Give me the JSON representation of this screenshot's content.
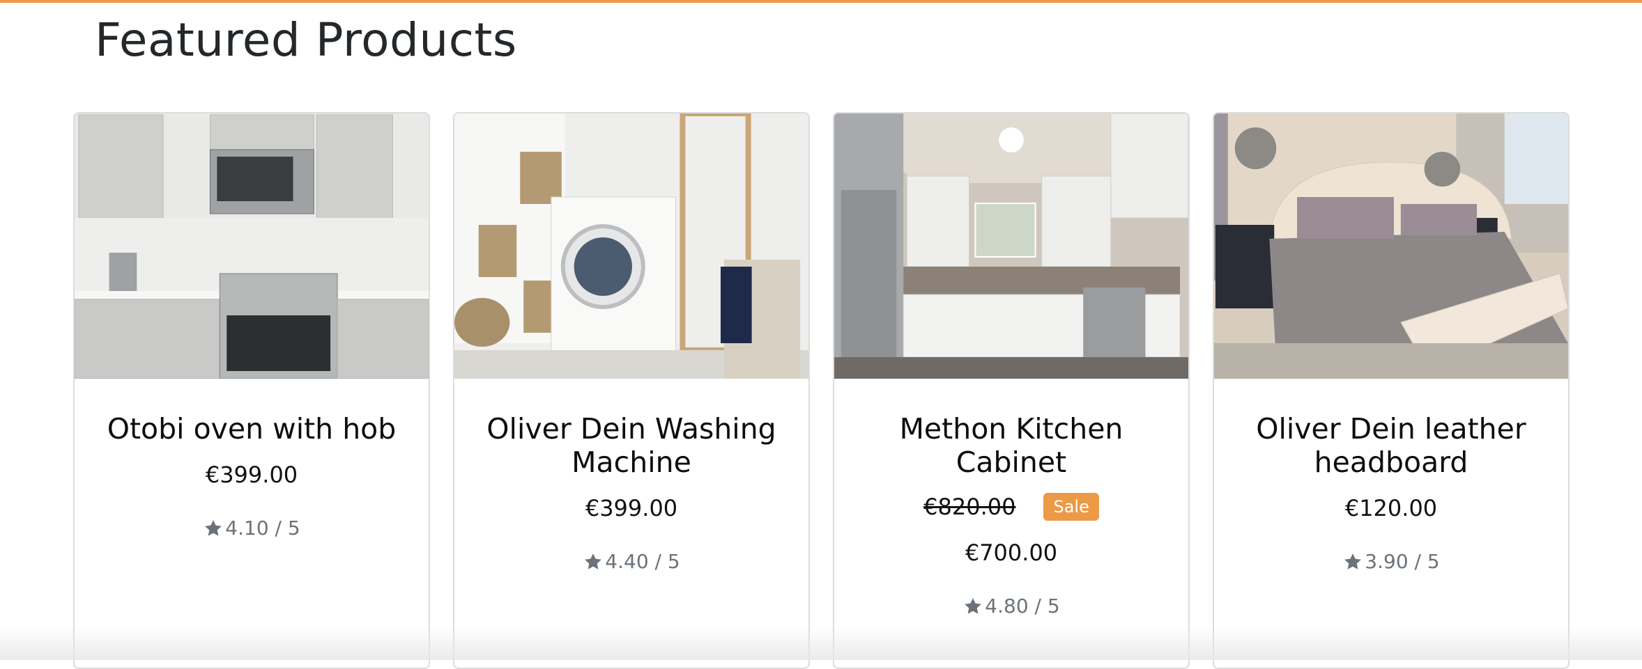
{
  "section": {
    "title": "Featured Products"
  },
  "colors": {
    "accent": "#ec9a45",
    "star": "#6b727a"
  },
  "products": [
    {
      "name": "Otobi oven with hob",
      "price": "€399.00",
      "rating": "4.10 / 5",
      "image": "kitchen-oven-photo"
    },
    {
      "name": "Oliver Dein Washing Machine",
      "price": "€399.00",
      "rating": "4.40 / 5",
      "image": "washing-machine-photo"
    },
    {
      "name": "Methon Kitchen Cabinet",
      "old_price": "€820.00",
      "sale_label": "Sale",
      "price": "€700.00",
      "rating": "4.80 / 5",
      "image": "kitchen-cabinet-photo"
    },
    {
      "name": "Oliver Dein leather headboard",
      "price": "€120.00",
      "rating": "3.90 / 5",
      "image": "bedroom-headboard-photo"
    }
  ]
}
